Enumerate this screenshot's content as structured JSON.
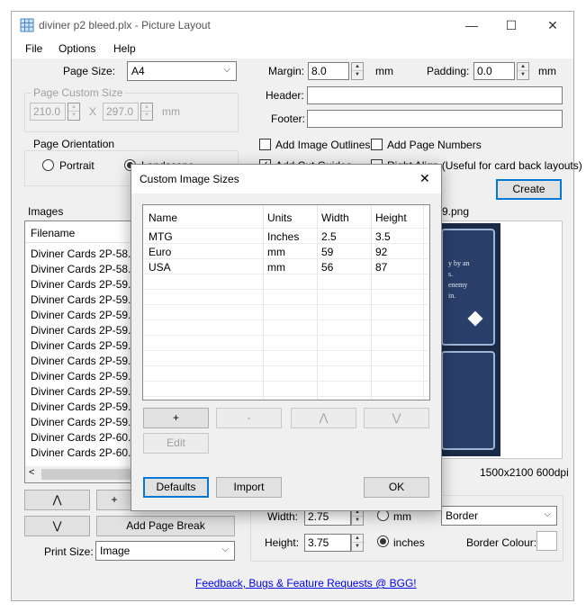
{
  "window": {
    "title": "diviner p2 bleed.plx - Picture Layout",
    "minimize": "—",
    "maximize": "☐",
    "close": "✕"
  },
  "menu": [
    "File",
    "Options",
    "Help"
  ],
  "page_size": {
    "label": "Page Size:",
    "value": "A4"
  },
  "page_custom_size": {
    "label": "Page Custom Size",
    "width": "210.0",
    "x": "X",
    "height": "297.0",
    "unit": "mm"
  },
  "margin": {
    "label": "Margin:",
    "value": "8.0",
    "unit": "mm"
  },
  "padding": {
    "label": "Padding:",
    "value": "0.0",
    "unit": "mm"
  },
  "header": {
    "label": "Header:",
    "value": ""
  },
  "footer": {
    "label": "Footer:",
    "value": ""
  },
  "orientation": {
    "label": "Page Orientation",
    "portrait": "Portrait",
    "landscape": "Landscape",
    "selected": "landscape"
  },
  "options": {
    "add_image_outlines": "Add Image Outlines",
    "add_page_numbers": "Add Page Numbers",
    "add_cut_guides": "Add Cut Guides",
    "right_align": "Right Align (Useful for card back layouts)"
  },
  "create_button": "Create",
  "images": {
    "label": "Images",
    "column": "Filename",
    "rows": [
      "Diviner Cards 2P-58...",
      "Diviner Cards 2P-58...",
      "Diviner Cards 2P-59...",
      "Diviner Cards 2P-59...",
      "Diviner Cards 2P-59...",
      "Diviner Cards 2P-59...",
      "Diviner Cards 2P-59...",
      "Diviner Cards 2P-59...",
      "Diviner Cards 2P-59...",
      "Diviner Cards 2P-59...",
      "Diviner Cards 2P-59...",
      "Diviner Cards 2P-59...",
      "Diviner Cards 2P-60...",
      "Diviner Cards 2P-60..."
    ]
  },
  "preview": {
    "filename_tail": "9.png",
    "resolution": "1500x2100 600dpi",
    "card_text": [
      "y by an",
      "s.",
      "enemy",
      "in."
    ]
  },
  "move_buttons": {
    "up": "⋀",
    "down": "⋁",
    "add": "+",
    "add_page_break": "Add Page Break"
  },
  "print_size": {
    "label": "Print Size:",
    "value": "Image"
  },
  "width": {
    "label": "Width:",
    "value": "2.75"
  },
  "height": {
    "label": "Height:",
    "value": "3.75"
  },
  "units": {
    "mm": "mm",
    "inches": "inches",
    "selected": "inches"
  },
  "border": {
    "value": "Border",
    "colour_label": "Border Colour:"
  },
  "feedback_link": "Feedback, Bugs & Feature Requests @ BGG!",
  "dialog": {
    "title": "Custom Image Sizes",
    "close": "✕",
    "columns": [
      "Name",
      "Units",
      "Width",
      "Height"
    ],
    "rows": [
      [
        "MTG",
        "Inches",
        "2.5",
        "3.5"
      ],
      [
        "Euro",
        "mm",
        "59",
        "92"
      ],
      [
        "USA",
        "mm",
        "56",
        "87"
      ]
    ],
    "buttons": {
      "add": "+",
      "remove": "-",
      "up": "⋀",
      "down": "⋁",
      "edit": "Edit"
    },
    "defaults": "Defaults",
    "import": "Import",
    "ok": "OK"
  }
}
